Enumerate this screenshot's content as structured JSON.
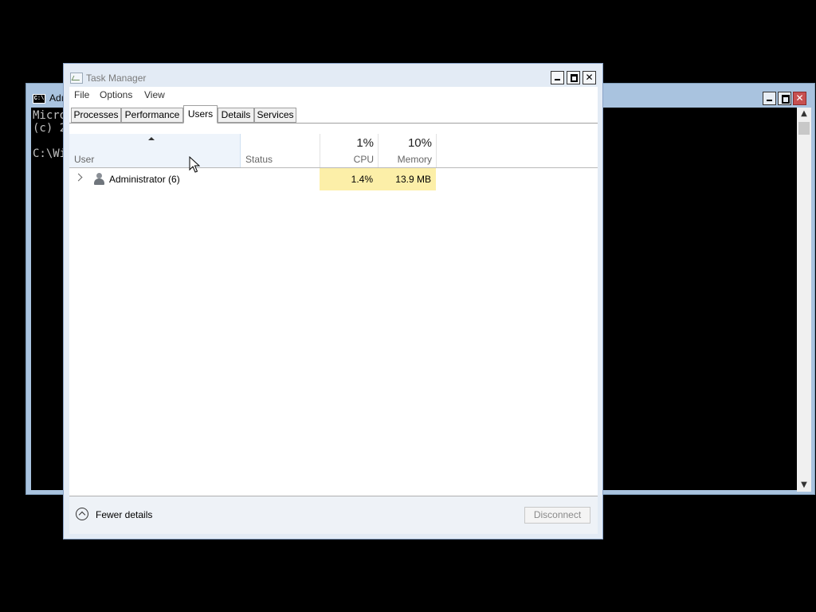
{
  "console": {
    "title": "Adı",
    "lines": [
      "Micro",
      "(c) 2",
      "",
      "C:\\Wi"
    ]
  },
  "task_manager": {
    "title": "Task Manager",
    "menu": [
      "File",
      "Options",
      "View"
    ],
    "tabs": [
      "Processes",
      "Performance",
      "Users",
      "Details",
      "Services"
    ],
    "active_tab": "Users",
    "columns": {
      "user": "User",
      "status": "Status",
      "cpu": {
        "percent": "1%",
        "label": "CPU"
      },
      "memory": {
        "percent": "10%",
        "label": "Memory"
      }
    },
    "rows": [
      {
        "user": "Administrator (6)",
        "status": "",
        "cpu": "1.4%",
        "memory": "13.9 MB"
      }
    ],
    "footer": {
      "fewer_details": "Fewer details",
      "disconnect": "Disconnect"
    }
  },
  "colors": {
    "heat": "#fcefa8",
    "window_frame": "#e3ebf5",
    "console_frame": "#a9c3df",
    "close_red": "#c75050"
  }
}
